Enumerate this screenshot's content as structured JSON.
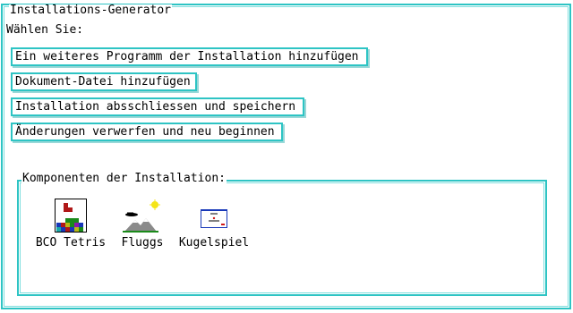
{
  "window": {
    "title": "Installations-Generator"
  },
  "prompt": "Wählen Sie:",
  "menu": {
    "items": [
      {
        "label": "Ein weiteres Programm der Installation hinzufügen"
      },
      {
        "label": "Dokument-Datei hinzufügen"
      },
      {
        "label": "Installation absschliessen und speichern"
      },
      {
        "label": "Änderungen verwerfen und neu beginnen"
      }
    ]
  },
  "components": {
    "title": "Komponenten der Installation:",
    "items": [
      {
        "label": "BCO Tetris",
        "icon": "tetris-icon"
      },
      {
        "label": "Fluggs",
        "icon": "fluggs-icon"
      },
      {
        "label": "Kugelspiel",
        "icon": "kugelspiel-icon"
      }
    ]
  },
  "colors": {
    "frame": "#2ec4c4",
    "background": "#ffffff",
    "text": "#000000"
  }
}
